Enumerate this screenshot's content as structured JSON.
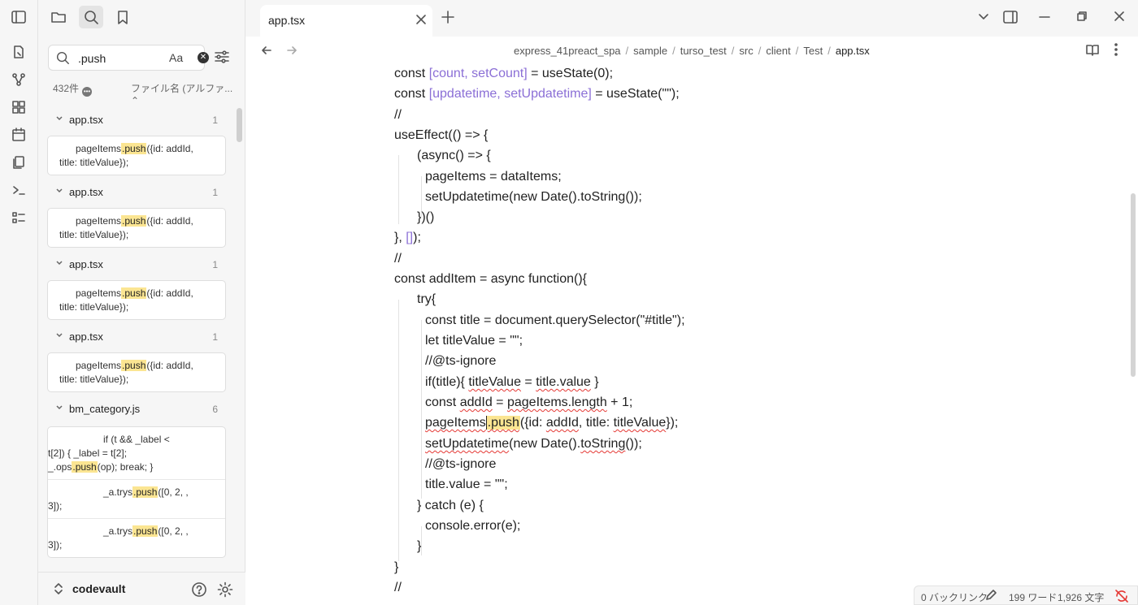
{
  "ribbon": {
    "icons": [
      "sidebar-toggle-icon",
      "new-note-icon",
      "graph-icon",
      "canvas-icon",
      "calendar-icon",
      "templates-icon",
      "terminal-icon",
      "tasks-icon"
    ]
  },
  "sidebar": {
    "tabs": [
      "files-icon",
      "search-icon",
      "bookmark-icon"
    ],
    "search": {
      "value": ".push",
      "case_label": "Aa"
    },
    "result_count": "432件",
    "sort_label": "ファイル名 (アルファ...",
    "groups": [
      {
        "file": "app.tsx",
        "count": "1",
        "matches": [
          {
            "pre": "pageItems",
            "hit": ".push",
            "post": "({id: addId,",
            "line2": "title: titleValue});"
          }
        ]
      },
      {
        "file": "app.tsx",
        "count": "1",
        "matches": [
          {
            "pre": "pageItems",
            "hit": ".push",
            "post": "({id: addId,",
            "line2": "title: titleValue});"
          }
        ]
      },
      {
        "file": "app.tsx",
        "count": "1",
        "matches": [
          {
            "pre": "pageItems",
            "hit": ".push",
            "post": "({id: addId,",
            "line2": "title: titleValue});"
          }
        ]
      },
      {
        "file": "app.tsx",
        "count": "1",
        "matches": [
          {
            "pre": "pageItems",
            "hit": ".push",
            "post": "({id: addId,",
            "line2": "title: titleValue});"
          }
        ]
      }
    ],
    "bm_group": {
      "file": "bm_category.js",
      "count": "6",
      "matches": [
        {
          "l1": "if (t && _label <",
          "l2": "t[2]) { _label = t[2];",
          "l3pre": "_.ops",
          "hit": ".push",
          "l3post": "(op); break; }"
        },
        {
          "l1pre": "_a.trys",
          "hit": ".push",
          "l1post": "([0, 2, ,",
          "l2": "3]);"
        },
        {
          "l1pre": "_a.trys",
          "hit": ".push",
          "l1post": "([0, 2, ,",
          "l2": "3]);"
        }
      ]
    },
    "vault_name": "codevault"
  },
  "tab": {
    "label": "app.tsx"
  },
  "breadcrumb": [
    "express_41preact_spa",
    "sample",
    "turso_test",
    "src",
    "client",
    "Test",
    "app.tsx"
  ],
  "code": {
    "l1": {
      "a": "const ",
      "b": "[count, setCount]",
      "c": " = useState(0);"
    },
    "l2": {
      "a": "const ",
      "b": "[updatetime, setUpdatetime]",
      "c": " = useState(\"\");"
    },
    "l3": "//",
    "l4": "useEffect(() => {",
    "l5": "(async() => {",
    "l6": "pageItems = dataItems;",
    "l7": "setUpdatetime(new Date().toString());",
    "l8": "})()",
    "l9a": "}, ",
    "l9b": "[]",
    "l9c": ");",
    "l10": "//",
    "l11": "const addItem = async function(){",
    "l12": "try{",
    "l13": "const title = document.querySelector(\"#title\");",
    "l14": "let titleValue = \"\";",
    "l15": "//@ts-ignore",
    "l16": {
      "a": "if(title){ ",
      "b": "titleValue",
      "c": " = ",
      "d": "title.value",
      "e": " }"
    },
    "l17": {
      "a": "const ",
      "b": "addId",
      "c": " = ",
      "d": "pageItems.length",
      "e": " + 1;"
    },
    "l18": {
      "a": "pageItems",
      "b": ".push",
      "c": "({id: ",
      "d": "addId",
      "e": ", title: ",
      "f": "titleValue",
      "g": "});"
    },
    "l19": {
      "a": "setUpdatetime",
      "b": "(new Date().",
      "c": "toString",
      "d": "());"
    },
    "l20": "//@ts-ignore",
    "l21": "title.value = \"\";",
    "l22": "} catch (e) {",
    "l23": "console.error(e);",
    "l24": "}",
    "l25": "}",
    "l26": "//"
  },
  "status": {
    "backlinks": "0 バックリンク",
    "words": "199 ワード",
    "chars": "1,926 文字"
  }
}
